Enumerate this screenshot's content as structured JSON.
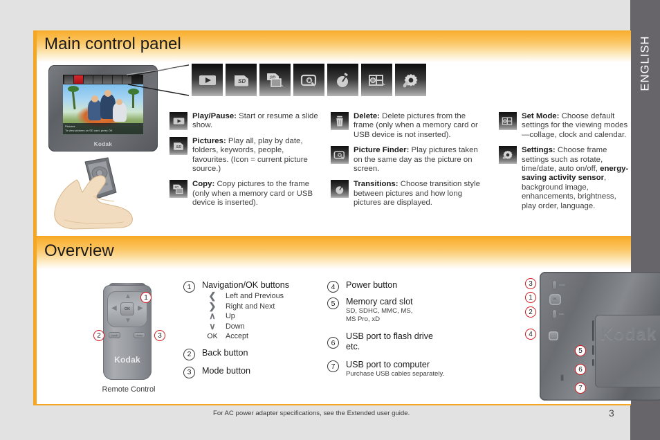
{
  "page": {
    "background_color": "#e2e2e2",
    "page_number": "3",
    "footer_note": "For AC power adapter specifications, see the Extended user guide.",
    "language_tab": "ENGLISH",
    "accent_color": "#f5a623",
    "callout_red": "#d0161c"
  },
  "sections": {
    "main_control_panel": {
      "title": "Main control panel",
      "frame_illustration": {
        "brand": "Kodak",
        "caption_line1": "Pictures",
        "caption_line2": "To view pictures on SD card, press OK"
      },
      "icon_strip": [
        {
          "name": "play-pause-icon",
          "label": "Play/Pause"
        },
        {
          "name": "pictures-sd-icon",
          "label": "Pictures"
        },
        {
          "name": "copy-icon",
          "label": "Copy"
        },
        {
          "name": "picture-finder-icon",
          "label": "Picture Finder"
        },
        {
          "name": "transitions-icon",
          "label": "Transitions"
        },
        {
          "name": "set-mode-icon",
          "label": "Set Mode"
        },
        {
          "name": "settings-gear-icon",
          "label": "Settings"
        }
      ],
      "columns": [
        [
          {
            "icon": "play-pause-icon",
            "term": "Play/Pause:",
            "text": " Start or resume a slide show."
          },
          {
            "icon": "pictures-sd-icon",
            "term": "Pictures:",
            "text": " Play all, play by date, folders, keywords, people, favourites. (Icon = current picture source.)"
          },
          {
            "icon": "copy-icon",
            "term": "Copy:",
            "text": " Copy pictures to the frame (only when a memory card or USB device is inserted)."
          }
        ],
        [
          {
            "icon": "delete-trash-icon",
            "term": "Delete:",
            "text": " Delete pictures from the frame (only when a memory card or USB device is not inserted)."
          },
          {
            "icon": "picture-finder-icon",
            "term": "Picture Finder:",
            "text": " Play pictures taken on the same day as the picture on screen."
          },
          {
            "icon": "transitions-icon",
            "term": "Transitions:",
            "text": " Choose transition style between pictures and how long pictures are displayed."
          }
        ],
        [
          {
            "icon": "set-mode-icon",
            "term": "Set Mode:",
            "text": " Choose default settings for the viewing modes—collage, clock and calendar."
          },
          {
            "icon": "settings-gear-icon",
            "term": "Settings:",
            "text": " Choose frame settings such as rotate, time/date, auto on/off, ",
            "bold_mid": "energy-saving activity sensor",
            "text2": ", background image, enhancements, brightness, play order, language."
          }
        ]
      ]
    },
    "overview": {
      "title": "Overview",
      "remote": {
        "label": "Remote Control",
        "brand": "Kodak",
        "ok_label": "OK",
        "back_label": "back",
        "mode_label": "mode"
      },
      "list_left": [
        {
          "num": "1",
          "title": "Navigation/OK buttons",
          "rows": [
            {
              "symbol": "❮",
              "label": "Left and Previous"
            },
            {
              "symbol": "❯",
              "label": "Right and Next"
            },
            {
              "symbol": "∧",
              "label": "Up"
            },
            {
              "symbol": "∨",
              "label": "Down"
            },
            {
              "symbol": "OK",
              "label": "Accept"
            }
          ]
        },
        {
          "num": "2",
          "title": "Back button",
          "rows": []
        },
        {
          "num": "3",
          "title": "Mode button",
          "rows": []
        }
      ],
      "list_right": [
        {
          "num": "4",
          "title": "Power button",
          "sub": ""
        },
        {
          "num": "5",
          "title": "Memory card slot",
          "sub": "SD, SDHC, MMC, MS,",
          "sub2": "MS Pro, xD"
        },
        {
          "num": "6",
          "title": "USB port to flash drive",
          "sub": "etc.",
          "sub_is_title": true
        },
        {
          "num": "7",
          "title": "USB port to computer",
          "sub": "Purchase USB cables separately."
        }
      ],
      "back_view": {
        "brand": "Kodak",
        "mode_label": "mode",
        "ok_label": "OK",
        "back_label": "back",
        "badges": [
          "3",
          "1",
          "2",
          "4",
          "5",
          "6",
          "7"
        ]
      }
    }
  }
}
